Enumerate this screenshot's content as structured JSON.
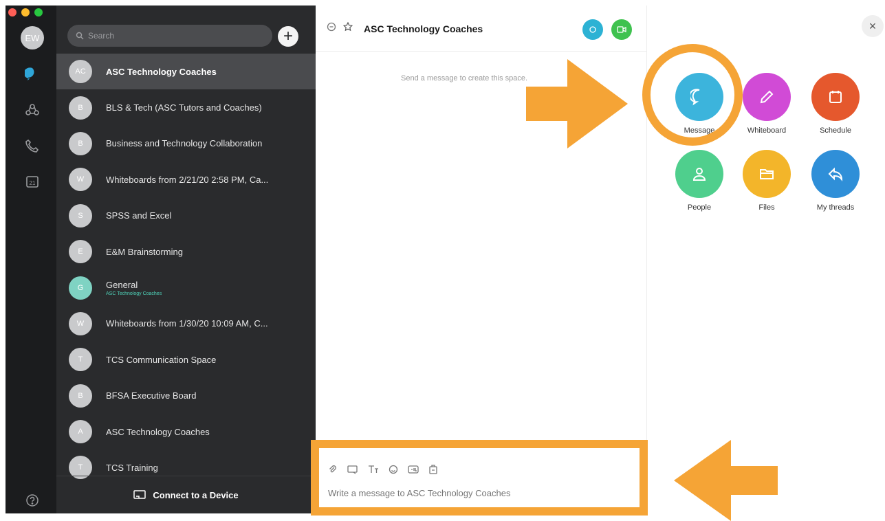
{
  "window": {
    "traffic_colors": [
      "#fe5f57",
      "#febc2e",
      "#28c840"
    ]
  },
  "rail": {
    "user_initials": "EW",
    "calendar_day": "21"
  },
  "space_list": {
    "search_placeholder": "Search",
    "add_label": "+",
    "items": [
      {
        "initial": "AC",
        "name": "ASC Technology Coaches",
        "subtitle": "",
        "active": true,
        "avatar_color": "#c9cacc"
      },
      {
        "initial": "B",
        "name": "BLS & Tech (ASC Tutors and Coaches)",
        "subtitle": "",
        "active": false,
        "avatar_color": "#c9cacc"
      },
      {
        "initial": "B",
        "name": "Business and Technology Collaboration",
        "subtitle": "",
        "active": false,
        "avatar_color": "#c9cacc"
      },
      {
        "initial": "W",
        "name": "Whiteboards from 2/21/20 2:58 PM, Ca...",
        "subtitle": "",
        "active": false,
        "avatar_color": "#c9cacc"
      },
      {
        "initial": "S",
        "name": "SPSS and Excel",
        "subtitle": "",
        "active": false,
        "avatar_color": "#c9cacc"
      },
      {
        "initial": "E",
        "name": "E&M Brainstorming",
        "subtitle": "",
        "active": false,
        "avatar_color": "#c9cacc"
      },
      {
        "initial": "G",
        "name": "General",
        "subtitle": "ASC Technology Coaches",
        "active": false,
        "avatar_color": "#7fd3c3"
      },
      {
        "initial": "W",
        "name": "Whiteboards from 1/30/20 10:09 AM, C...",
        "subtitle": "",
        "active": false,
        "avatar_color": "#c9cacc"
      },
      {
        "initial": "T",
        "name": "TCS Communication Space",
        "subtitle": "",
        "active": false,
        "avatar_color": "#c9cacc"
      },
      {
        "initial": "B",
        "name": "BFSA Executive Board",
        "subtitle": "",
        "active": false,
        "avatar_color": "#c9cacc"
      },
      {
        "initial": "A",
        "name": "ASC Technology Coaches",
        "subtitle": "",
        "active": false,
        "avatar_color": "#c9cacc"
      },
      {
        "initial": "T",
        "name": "TCS Training",
        "subtitle": "",
        "active": false,
        "avatar_color": "#c9cacc"
      }
    ],
    "connect_label": "Connect to a Device"
  },
  "conversation": {
    "title": "ASC Technology Coaches",
    "empty_hint": "Send a message to create this space.",
    "composer_placeholder": "Write a message to ASC Technology Coaches",
    "header_button_colors": [
      "#2db2d4",
      "#3fc24f"
    ]
  },
  "actions": {
    "close_label": "×",
    "items": [
      {
        "label": "Message",
        "icon": "message-icon",
        "color": "#3cb4dc"
      },
      {
        "label": "Whiteboard",
        "icon": "pencil-icon",
        "color": "#d14bd6"
      },
      {
        "label": "Schedule",
        "icon": "calendar-icon",
        "color": "#e5582d"
      },
      {
        "label": "People",
        "icon": "person-icon",
        "color": "#4fcf8d"
      },
      {
        "label": "Files",
        "icon": "folder-icon",
        "color": "#f3b52a"
      },
      {
        "label": "My threads",
        "icon": "reply-icon",
        "color": "#2f8fd8"
      }
    ]
  },
  "annotation_color": "#f5a436"
}
